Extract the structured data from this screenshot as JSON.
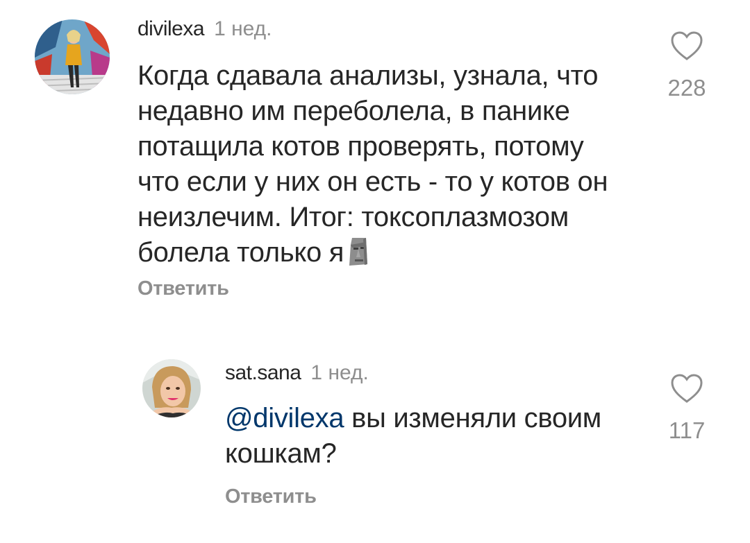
{
  "comments": [
    {
      "username": "divilexa",
      "time": "1 нед.",
      "lines": [
        "Когда сдавала анализы, узнала, что",
        "недавно им переболела, в панике",
        "потащила котов проверять, потому",
        "что если у них он есть - то у котов он",
        "неизлечим. Итог: токсоплазмозом",
        "болела только я"
      ],
      "emoji": "moai-emoji",
      "reply_label": "Ответить",
      "likes": "228"
    },
    {
      "username": "sat.sana",
      "time": "1 нед.",
      "mention": "@divilexa",
      "line1_rest": " вы изменяли своим",
      "line2": "кошкам?",
      "reply_label": "Ответить",
      "likes": "117"
    }
  ],
  "icons": {
    "like": "heart-outline-icon",
    "emoji": "moai-emoji"
  },
  "colors": {
    "text": "#262626",
    "secondary": "#8e8e8e",
    "mention": "#00376b",
    "background": "#ffffff"
  }
}
